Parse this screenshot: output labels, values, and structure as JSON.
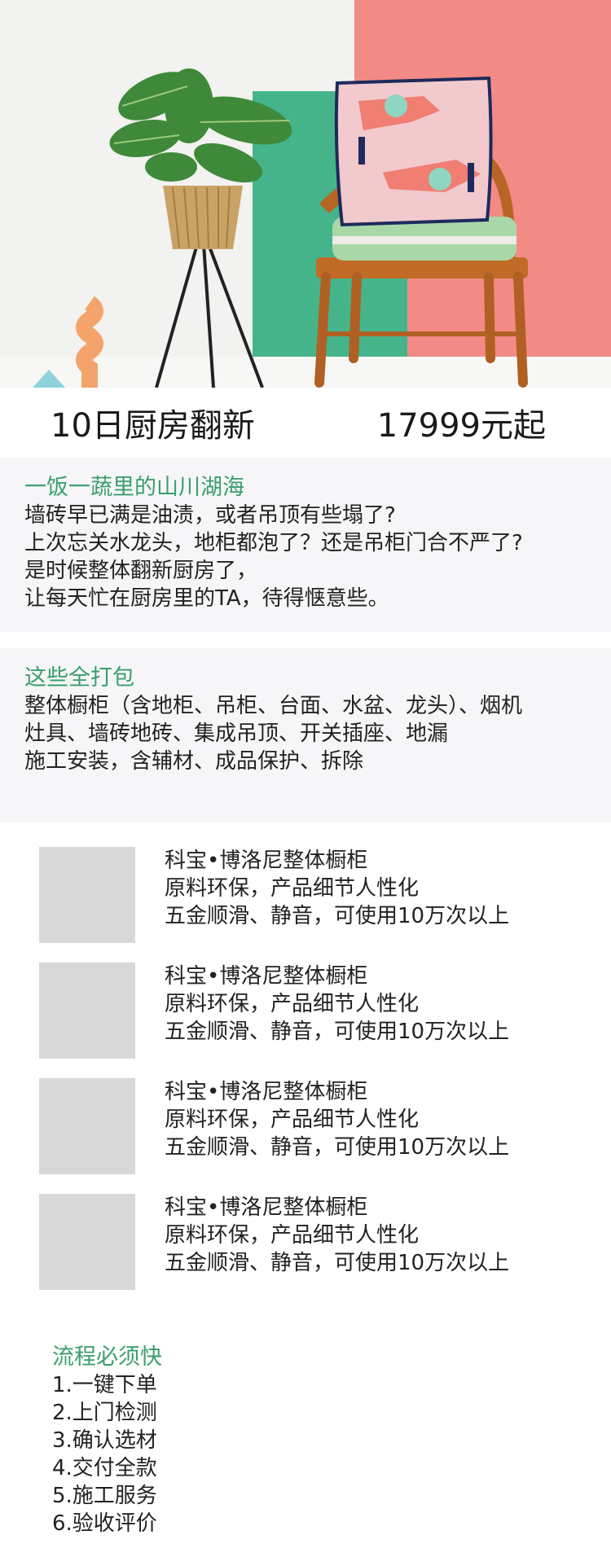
{
  "hero": {
    "image_label": "kitchen-hero-photo"
  },
  "title": {
    "name": "10日厨房翻新",
    "price": "17999元起"
  },
  "intro": {
    "heading": "一饭一蔬里的山川湖海",
    "lines": [
      "墙砖早已满是油渍，或者吊顶有些塌了?",
      "上次忘关水龙头，地柜都泡了？还是吊柜门合不严了?",
      "是时候整体翻新厨房了，",
      "让每天忙在厨房里的TA，待得惬意些。"
    ]
  },
  "package": {
    "heading": "这些全打包",
    "lines": [
      "整体橱柜（含地柜、吊柜、台面、水盆、龙头）、烟机",
      "灶具、墙砖地砖、集成吊顶、开关插座、地漏",
      "施工安装，含辅材、成品保护、拆除"
    ]
  },
  "products": [
    {
      "line1": "科宝•博洛尼整体橱柜",
      "line2": "原料环保，产品细节人性化",
      "line3": "五金顺滑、静音，可使用10万次以上"
    },
    {
      "line1": "科宝•博洛尼整体橱柜",
      "line2": "原料环保，产品细节人性化",
      "line3": "五金顺滑、静音，可使用10万次以上"
    },
    {
      "line1": "科宝•博洛尼整体橱柜",
      "line2": "原料环保，产品细节人性化",
      "line3": "五金顺滑、静音，可使用10万次以上"
    },
    {
      "line1": "科宝•博洛尼整体橱柜",
      "line2": "原料环保，产品细节人性化",
      "line3": "五金顺滑、静音，可使用10万次以上"
    }
  ],
  "process": {
    "heading": "流程必须快",
    "steps": [
      "1.一键下单",
      "2.上门检测",
      "3.确认选材",
      "4.交付全款",
      "5.施工服务",
      "6.验收评价"
    ]
  },
  "colors": {
    "accent": "#3a9e6e",
    "section_bg": "#f6f6f8",
    "placeholder": "#d8d8d8"
  }
}
